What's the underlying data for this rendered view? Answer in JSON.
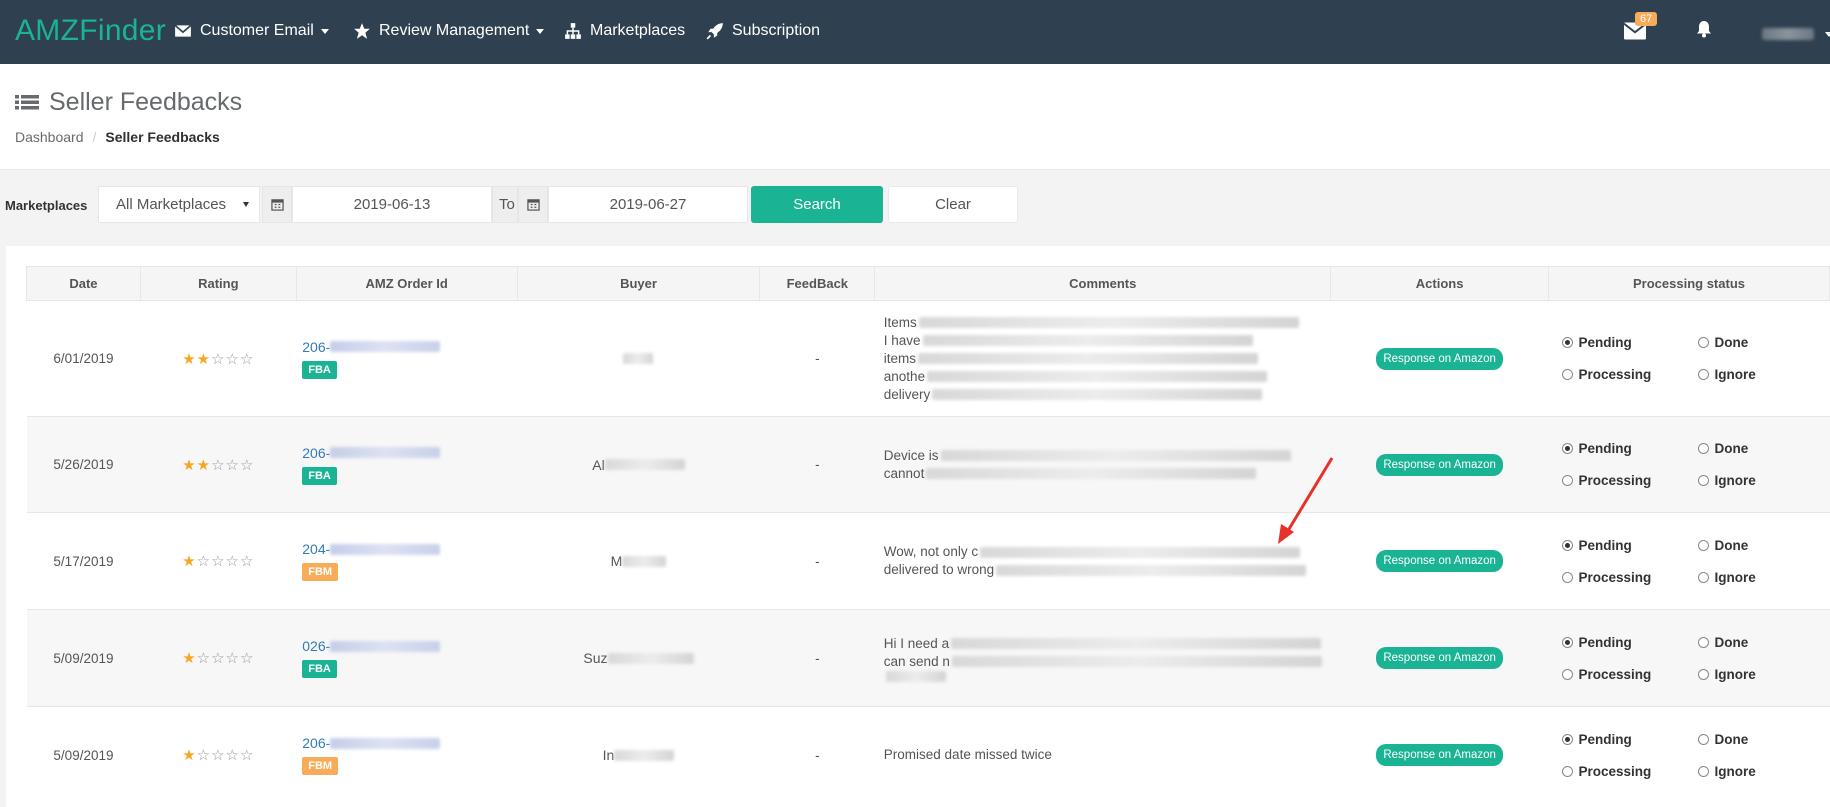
{
  "app": {
    "logo": "AMZFinder"
  },
  "nav": {
    "items": [
      {
        "label": "Customer Email",
        "icon": "envelope-icon",
        "dropdown": true
      },
      {
        "label": "Review Management",
        "icon": "star-icon",
        "dropdown": true
      },
      {
        "label": "Marketplaces",
        "icon": "sitemap-icon",
        "dropdown": false
      },
      {
        "label": "Subscription",
        "icon": "rocket-icon",
        "dropdown": false
      }
    ],
    "mail_badge": "67"
  },
  "page": {
    "title": "Seller Feedbacks",
    "breadcrumb": {
      "home": "Dashboard",
      "current": "Seller Feedbacks"
    }
  },
  "filter": {
    "label": "Marketplaces",
    "marketplace": "All Marketplaces",
    "date_from": "2019-06-13",
    "to_label": "To",
    "date_to": "2019-06-27",
    "search_label": "Search",
    "clear_label": "Clear"
  },
  "table": {
    "columns": [
      "Date",
      "Rating",
      "AMZ Order Id",
      "Buyer",
      "FeedBack",
      "Comments",
      "Actions",
      "Processing status"
    ],
    "action_label": "Response on Amazon",
    "status_labels": [
      "Pending",
      "Done",
      "Processing",
      "Ignore"
    ],
    "rows": [
      {
        "date": "6/01/2019",
        "rating": 2,
        "order": "206-",
        "tag": "FBA",
        "buyer": "",
        "feedback": "-",
        "comments": [
          "Items",
          "I have",
          "items",
          "anothe",
          "delivery"
        ]
      },
      {
        "date": "5/26/2019",
        "rating": 2,
        "order": "206-",
        "tag": "FBA",
        "buyer": "Al",
        "feedback": "-",
        "comments": [
          "Device is",
          "cannot"
        ]
      },
      {
        "date": "5/17/2019",
        "rating": 1,
        "order": "204-",
        "tag": "FBM",
        "buyer": "M",
        "feedback": "-",
        "comments": [
          "Wow, not only c",
          "delivered to wrong"
        ]
      },
      {
        "date": "5/09/2019",
        "rating": 1,
        "order": "026-",
        "tag": "FBA",
        "buyer": "Suz",
        "feedback": "-",
        "comments": [
          "Hi I need a",
          "can send n",
          ""
        ]
      },
      {
        "date": "5/09/2019",
        "rating": 1,
        "order": "206-",
        "tag": "FBM",
        "buyer": "In",
        "feedback": "-",
        "comments": [
          "Promised date missed twice"
        ]
      }
    ]
  },
  "colors": {
    "topbar": "#2f4050",
    "accent": "#1ab394",
    "warning": "#f8ac59",
    "link": "#337ab7",
    "star": "#f5a623",
    "arrow": "#e8312a"
  }
}
